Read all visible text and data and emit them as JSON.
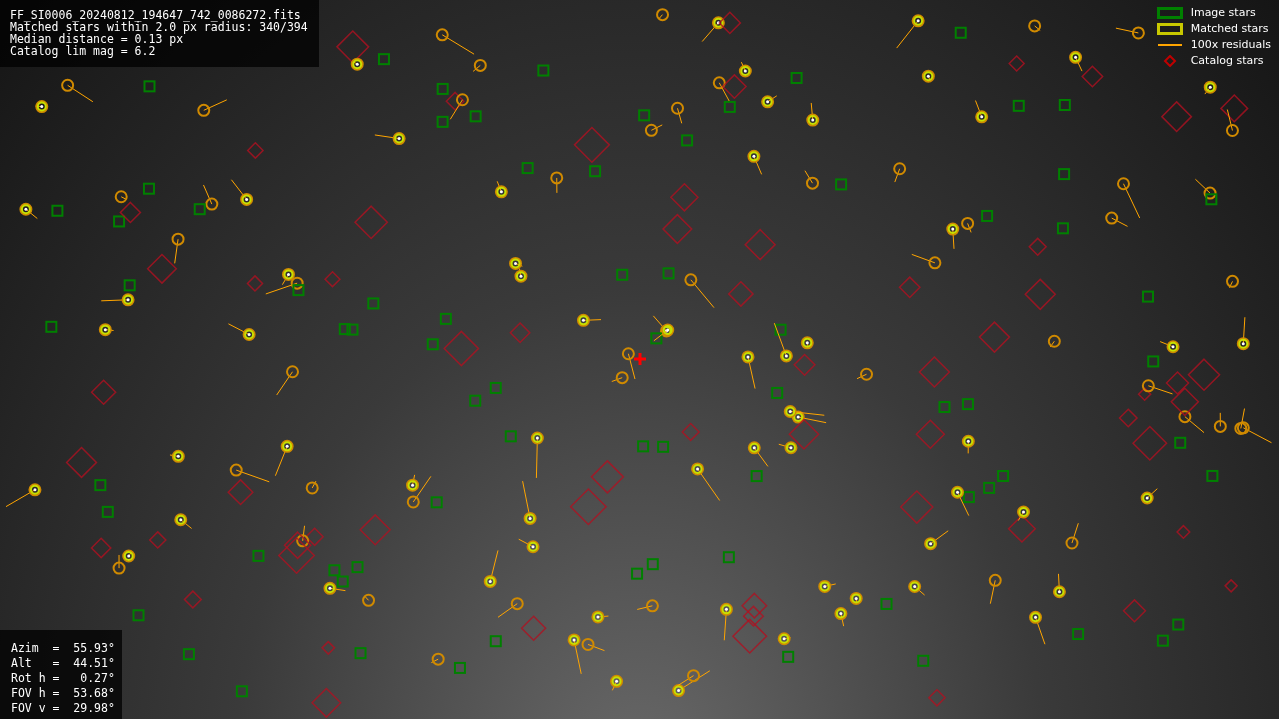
{
  "header_info": [
    "FF_SI0006_20240812_194647_742_0086272.fits",
    "Matched stars within 2.0 px radius: 340/394",
    "Median distance = 0.13 px",
    "Catalog lim mag = 6.2"
  ],
  "legend": [
    {
      "kind": "box",
      "label": "Image stars",
      "color": "#008000"
    },
    {
      "kind": "box",
      "label": "Matched stars",
      "color": "#c8c800"
    },
    {
      "kind": "line",
      "label": "100x residuals",
      "color": "#ffa500"
    },
    {
      "kind": "diamond",
      "label": "Catalog stars",
      "color": "#c00000"
    }
  ],
  "pointing_info": [
    "Azim  =  55.93°",
    "Alt   =  44.51°",
    "Rot h =   0.27°",
    "FOV h =  53.68°",
    "FOV v =  29.98°"
  ]
}
